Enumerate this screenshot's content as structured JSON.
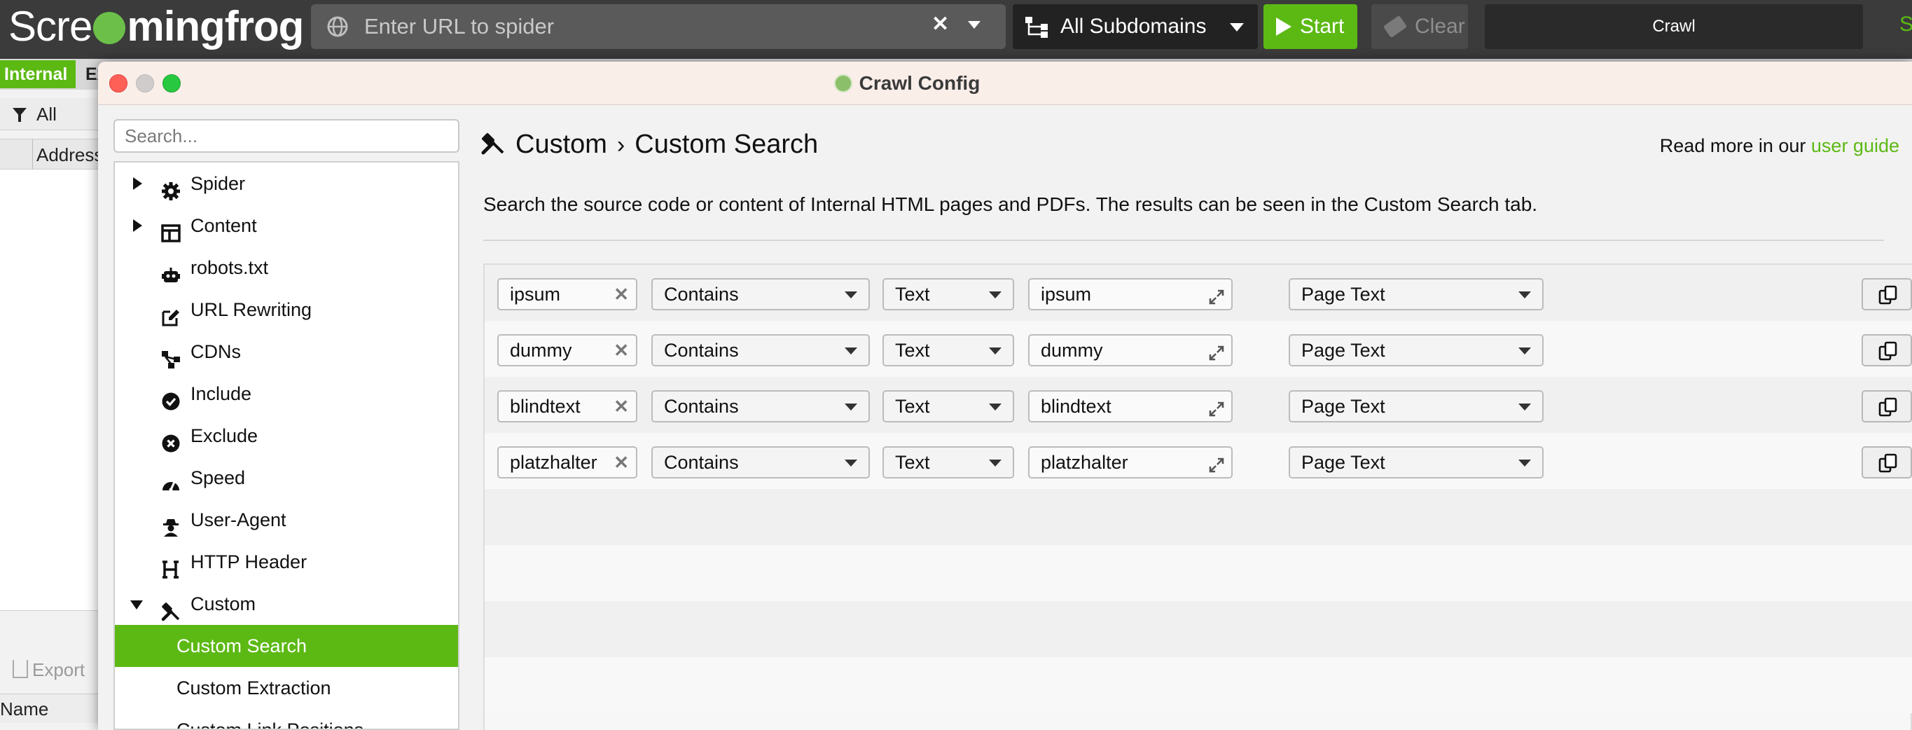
{
  "app": {
    "logo_word": "Scre",
    "logo_word2": "mingfrog",
    "url_placeholder": "Enter URL to spider",
    "clear_icon": "close-icon",
    "subdomain_mode": "All Subdomains",
    "start_label": "Start",
    "clear_label": "Clear",
    "crawl_label": "Crawl",
    "edge_letter": "S"
  },
  "background": {
    "tab_internal": "Internal",
    "tab_ex": "Ex",
    "filter_label": "All",
    "address_header": "Address",
    "export_label": "Export",
    "name_header": "Name"
  },
  "dialog": {
    "title": "Crawl Config",
    "search_placeholder": "Search...",
    "sidebar": [
      {
        "label": "Spider",
        "icon": "gear-icon",
        "expander": "collapsed"
      },
      {
        "label": "Content",
        "icon": "layout-icon",
        "expander": "collapsed"
      },
      {
        "label": "robots.txt",
        "icon": "robot-icon",
        "expander": "none"
      },
      {
        "label": "URL Rewriting",
        "icon": "edit-icon",
        "expander": "none"
      },
      {
        "label": "CDNs",
        "icon": "network-icon",
        "expander": "none"
      },
      {
        "label": "Include",
        "icon": "check-circle-icon",
        "expander": "none"
      },
      {
        "label": "Exclude",
        "icon": "x-circle-icon",
        "expander": "none"
      },
      {
        "label": "Speed",
        "icon": "speedometer-icon",
        "expander": "none"
      },
      {
        "label": "User-Agent",
        "icon": "user-secret-icon",
        "expander": "none"
      },
      {
        "label": "HTTP Header",
        "icon": "heading-icon",
        "expander": "none"
      },
      {
        "label": "Custom",
        "icon": "tools-icon",
        "expander": "expanded"
      },
      {
        "label": "Custom Search",
        "icon": "",
        "expander": "child",
        "active": true
      },
      {
        "label": "Custom Extraction",
        "icon": "",
        "expander": "child"
      },
      {
        "label": "Custom Link Positions",
        "icon": "",
        "expander": "child"
      }
    ],
    "breadcrumb_parent": "Custom",
    "breadcrumb_sep": "›",
    "breadcrumb_current": "Custom Search",
    "readmore_prefix": "Read more in our ",
    "readmore_link": "user guide",
    "description": "Search the source code or content of Internal HTML pages and PDFs. The results can be seen in the Custom Search tab.",
    "accent_color": "#5cb914",
    "rows": [
      {
        "name": "ipsum",
        "operator": "Contains",
        "type": "Text",
        "value": "ipsum",
        "scope": "Page Text"
      },
      {
        "name": "dummy",
        "operator": "Contains",
        "type": "Text",
        "value": "dummy",
        "scope": "Page Text"
      },
      {
        "name": "blindtext",
        "operator": "Contains",
        "type": "Text",
        "value": "blindtext",
        "scope": "Page Text"
      },
      {
        "name": "platzhalter",
        "operator": "Contains",
        "type": "Text",
        "value": "platzhalter",
        "scope": "Page Text"
      }
    ]
  }
}
